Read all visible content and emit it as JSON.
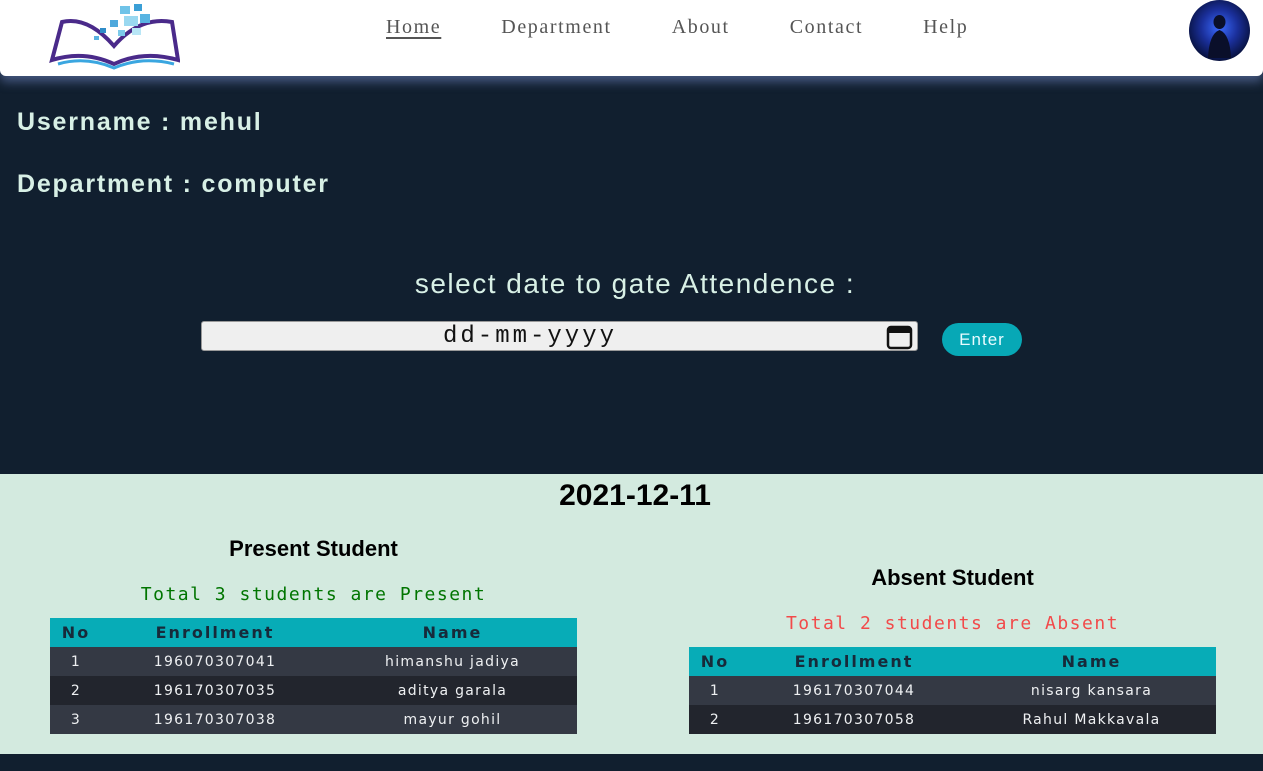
{
  "nav": {
    "links": [
      "Home",
      "Department",
      "About",
      "Contact",
      "Help"
    ]
  },
  "user": {
    "username_line": "Username : mehul",
    "department_line": "Department : computer"
  },
  "attendance_form": {
    "prompt": "select date to gate Attendence :",
    "date_placeholder": "dd-mm-yyyy",
    "enter_label": "Enter"
  },
  "results": {
    "date": "2021-12-11",
    "present": {
      "title": "Present Student",
      "total_text": "Total 3 students are Present",
      "columns": [
        "No",
        "Enrollment",
        "Name"
      ],
      "rows": [
        [
          "1",
          "196070307041",
          "himanshu jadiya"
        ],
        [
          "2",
          "196170307035",
          "aditya garala"
        ],
        [
          "3",
          "196170307038",
          "mayur gohil"
        ]
      ]
    },
    "absent": {
      "title": "Absent Student",
      "total_text": "Total 2 students are Absent",
      "columns": [
        "No",
        "Enrollment",
        "Name"
      ],
      "rows": [
        [
          "1",
          "196170307044",
          "nisarg kansara"
        ],
        [
          "2",
          "196170307058",
          "Rahul Makkavala"
        ]
      ]
    }
  },
  "colors": {
    "background_dark": "#111f2f",
    "results_bg": "#d3eadf",
    "accent_teal": "#07a8b6",
    "present_green": "#007500",
    "absent_red": "#f24a4a"
  },
  "icons": {
    "logo": "open-book-logo-icon",
    "calendar": "calendar-icon",
    "avatar": "user-avatar"
  }
}
